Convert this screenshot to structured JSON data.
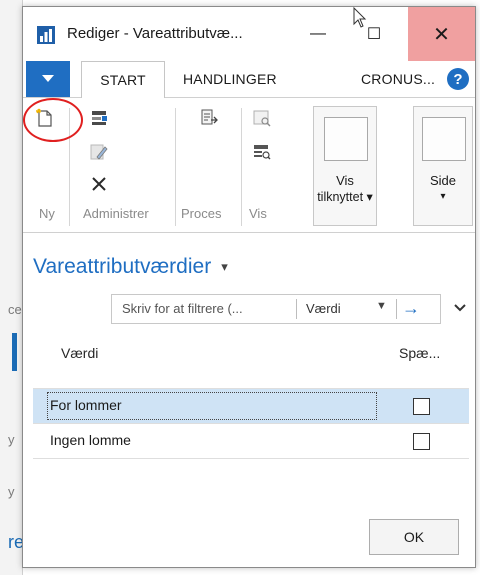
{
  "background": {
    "fragments": [
      "ce",
      "y",
      "y",
      "re"
    ]
  },
  "window": {
    "title": "Rediger - Vareattributvæ...",
    "minimize_glyph": "—",
    "maximize_glyph": "☐",
    "close_glyph": "✕"
  },
  "ribbon": {
    "tabs": [
      "START",
      "HANDLINGER",
      "CRONUS..."
    ],
    "help_glyph": "?",
    "groups": [
      "Ny",
      "Administrer",
      "Proces",
      "Vis"
    ],
    "big_buttons": {
      "show_attached_line1": "Vis",
      "show_attached_line2": "tilknyttet ▾",
      "page_line1": "Side",
      "page_line2": "▾"
    }
  },
  "page": {
    "title": "Vareattributværdier",
    "title_caret": "▾",
    "filter": {
      "placeholder": "Skriv for at filtrere (...",
      "field": "Værdi",
      "dropdown_glyph": "▼",
      "go_glyph": "→"
    },
    "columns": [
      "Værdi",
      "Spæ..."
    ],
    "rows": [
      {
        "value": "For lommer",
        "blocked": false,
        "selected": true
      },
      {
        "value": "Ingen lomme",
        "blocked": false,
        "selected": false
      }
    ],
    "ok_label": "OK"
  },
  "colors": {
    "accent": "#1f6ec2",
    "selected_row": "#cfe3f5",
    "close_button": "#f0a0a0",
    "highlight_ellipse": "#e02020"
  },
  "icons": [
    "app-icon",
    "new-icon",
    "edit-list-icon",
    "edit-icon",
    "delete-icon",
    "process-icon",
    "view-icon",
    "view-list-icon",
    "go-arrow-icon",
    "chevron-down-icon"
  ]
}
